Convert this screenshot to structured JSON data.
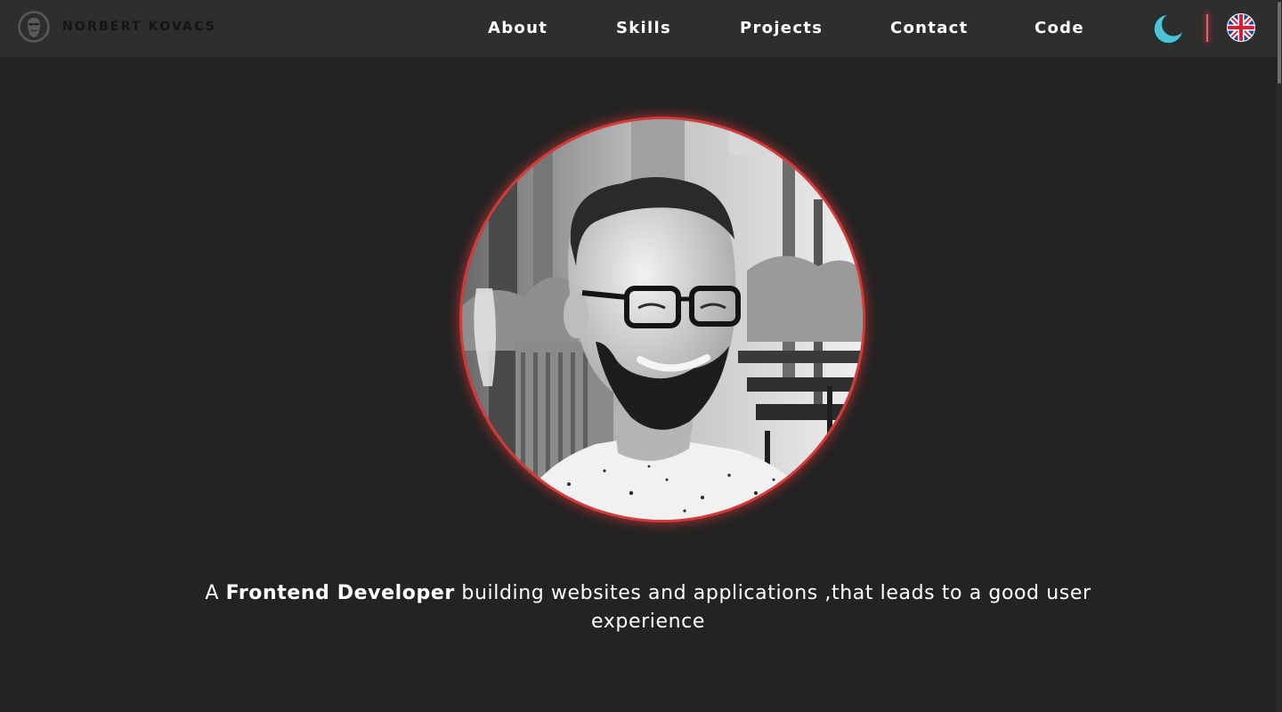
{
  "brand": {
    "name": "NORBERT KOVACS",
    "logo_icon": "bearded-face-icon"
  },
  "nav": {
    "links": [
      {
        "label": "About"
      },
      {
        "label": "Skills"
      },
      {
        "label": "Projects"
      },
      {
        "label": "Contact"
      },
      {
        "label": "Code"
      }
    ],
    "theme_icon": "moon-icon",
    "language_icon": "uk-flag-icon"
  },
  "hero": {
    "photo_icon": "profile-photo",
    "tagline_prefix": "A ",
    "tagline_highlight": "Frontend Developer",
    "tagline_suffix": " building websites and applications ,that leads to a good user experience"
  },
  "colors": {
    "background": "#232323",
    "navbar": "#2e2e2e",
    "accent_red": "#d33a3a",
    "moon": "#4ec3d3",
    "text": "#ffffff"
  }
}
